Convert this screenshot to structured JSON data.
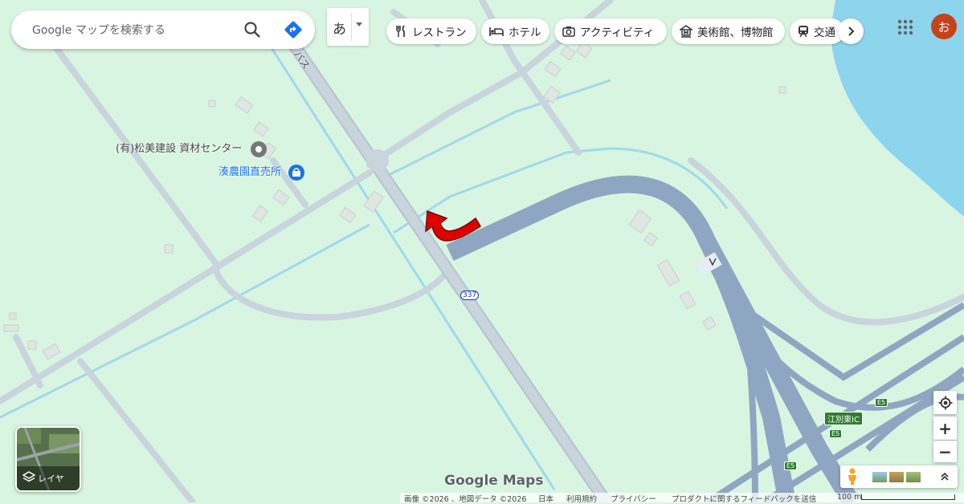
{
  "search": {
    "placeholder": "Google マップを検索する"
  },
  "ime": {
    "label": "あ"
  },
  "chips": [
    {
      "label": "レストラン",
      "icon": "fork-knife-icon"
    },
    {
      "label": "ホテル",
      "icon": "bed-icon"
    },
    {
      "label": "アクティビティ",
      "icon": "camera-icon"
    },
    {
      "label": "美術館、博物館",
      "icon": "museum-icon"
    },
    {
      "label": "交通",
      "icon": "train-icon"
    }
  ],
  "account": {
    "initial": "お",
    "color": "#c5421b"
  },
  "map": {
    "places": [
      {
        "name": "(有)松美建設 資材センター",
        "icon": "place-pin-icon",
        "color": "#444444"
      },
      {
        "name": "湊農園直売所",
        "icon": "shopping-bag-icon",
        "color": "#1a73e8"
      }
    ],
    "road_label_fragment": "バス",
    "route_number": "337",
    "interchange": "江別東IC",
    "expressway": [
      "E5",
      "E5",
      "E5"
    ],
    "colors": {
      "land": "#d8f5e1",
      "road": "#c9d4dd",
      "highway": "#8fa6c2",
      "water": "#8dd5ec",
      "arrow": "#e00000"
    }
  },
  "layers": {
    "label": "レイヤ"
  },
  "controls": {
    "zoom_in": "+",
    "zoom_out": "−"
  },
  "brand": {
    "text": "Google Maps"
  },
  "footer": {
    "imagery": "画像 ©2026 、地図データ ©2026",
    "country": "日本",
    "terms": "利用規約",
    "privacy": "プライバシー",
    "feedback": "プロダクトに関するフィードバックを送信",
    "scale": "100 m"
  }
}
